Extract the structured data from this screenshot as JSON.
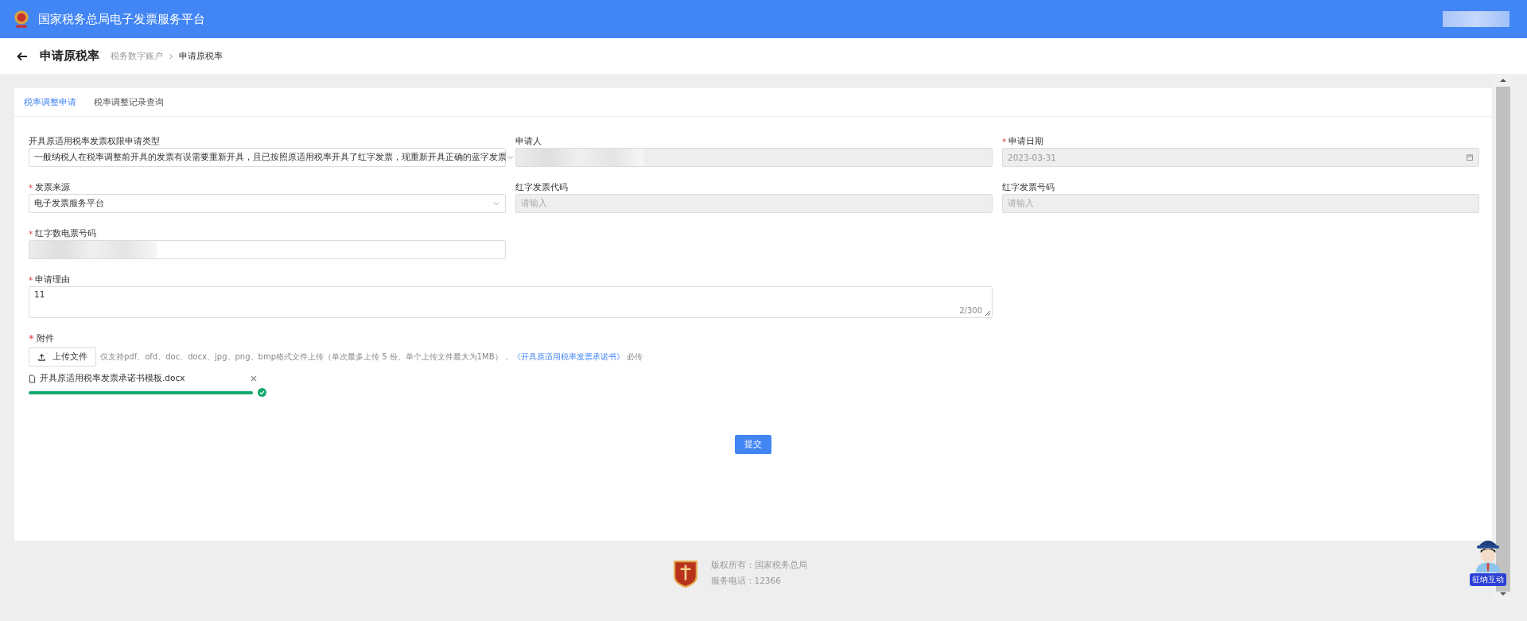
{
  "header": {
    "title": "国家税务总局电子发票服务平台"
  },
  "page": {
    "title": "申请原税率",
    "breadcrumb": [
      {
        "label": "税务数字账户",
        "current": false
      },
      {
        "label": "申请原税率",
        "current": true
      }
    ]
  },
  "tabs": [
    {
      "label": "税率调整申请",
      "selected": true
    },
    {
      "label": "税率调整记录查询",
      "selected": false
    }
  ],
  "form_rows": [
    [
      {
        "kind": "select",
        "label": "开具原适用税率发票权限申请类型",
        "required": false,
        "value": "一般纳税人在税率调整前开具的发票有误需要重新开具，且已按照原适用税率开具了红字发票，现重新开具正确的蓝字发票",
        "disabled": false
      },
      {
        "kind": "input",
        "label": "申请人",
        "required": false,
        "masked": true,
        "disabled": true
      },
      {
        "kind": "date",
        "label": "申请日期",
        "required": true,
        "value": "2023-03-31",
        "disabled": true
      }
    ],
    [
      {
        "kind": "select",
        "label": "发票来源",
        "required": true,
        "value": "电子发票服务平台",
        "disabled": false
      },
      {
        "kind": "input",
        "label": "红字发票代码",
        "required": false,
        "placeholder": "请输入",
        "disabled": true
      },
      {
        "kind": "input",
        "label": "红字发票号码",
        "required": false,
        "placeholder": "请输入",
        "disabled": true
      }
    ],
    [
      {
        "kind": "input",
        "label": "红字数电票号码",
        "required": true,
        "masked": true,
        "disabled": false
      }
    ],
    [
      {
        "kind": "textarea",
        "label": "申请理由",
        "required": true,
        "value": "11",
        "counter": "2/300",
        "disabled": false
      }
    ]
  ],
  "attachment": {
    "label": "附件",
    "required": true,
    "button": "上传文件",
    "hint": "仅支持pdf、ofd、doc、docx、jpg、png、bmp格式文件上传（单次最多上传 5 份、单个上传文件最大为1MB），",
    "link": "《开具原适用税率发票承诺书》",
    "suffix": "必传",
    "files": [
      {
        "name": "开具原适用税率发票承诺书模板.docx",
        "level": 1,
        "done": true
      }
    ]
  },
  "submit": "提交",
  "required_mark": "*",
  "footer": {
    "copyright": "版权所有：国家税务总局",
    "phone": "服务电话：12366"
  },
  "assistant": {
    "badge": "征纳互动"
  }
}
